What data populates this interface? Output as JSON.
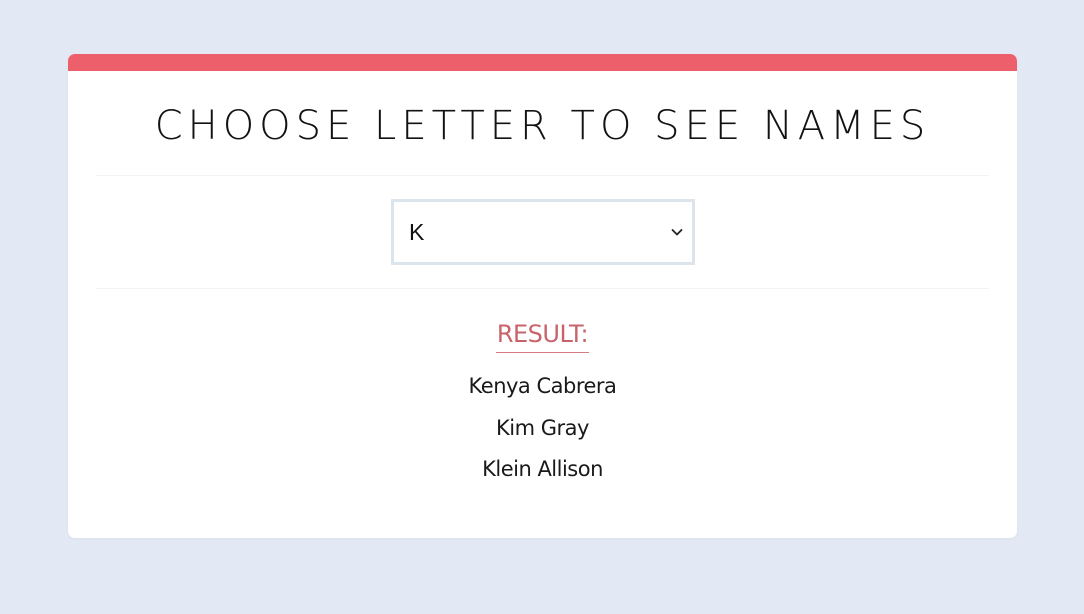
{
  "header": {
    "title": "CHOOSE LETTER TO SEE NAMES"
  },
  "letter_select": {
    "selected": "K"
  },
  "result": {
    "label": "RESULT:",
    "names": [
      "Kenya Cabrera",
      "Kim Gray",
      "Klein Allison"
    ]
  },
  "colors": {
    "accent": "#ec5f6b",
    "result_label": "#c9636b",
    "background": "#e3e9f4"
  },
  "icons": {
    "select_arrow": "chevron-down-icon"
  }
}
